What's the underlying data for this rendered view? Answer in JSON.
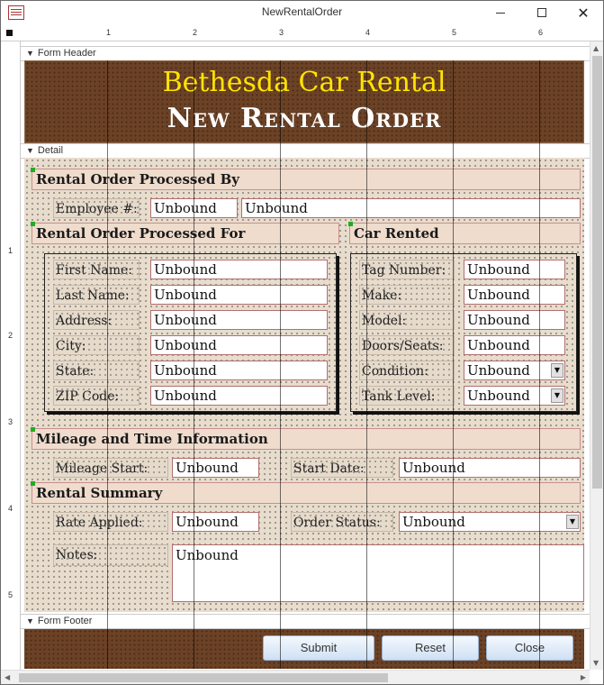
{
  "window": {
    "title": "NewRentalOrder"
  },
  "ruler": {
    "h_labels": [
      "1",
      "2",
      "3",
      "4",
      "5",
      "6"
    ],
    "v_labels": [
      "1",
      "2",
      "3",
      "4",
      "5"
    ]
  },
  "sections": {
    "header": "Form Header",
    "detail": "Detail",
    "footer": "Form Footer"
  },
  "header": {
    "company": "Bethesda Car Rental",
    "form_title": "New Rental Order"
  },
  "processed_by": {
    "band": "Rental Order Processed By",
    "employee_label": "Employee #:",
    "employee_number": "Unbound",
    "employee_name": "Unbound"
  },
  "processed_for": {
    "band": "Rental Order Processed For",
    "fields": [
      {
        "label": "First Name:",
        "value": "Unbound"
      },
      {
        "label": "Last Name:",
        "value": "Unbound"
      },
      {
        "label": "Address:",
        "value": "Unbound"
      },
      {
        "label": "City:",
        "value": "Unbound"
      },
      {
        "label": "State:",
        "value": "Unbound"
      },
      {
        "label": "ZIP Code:",
        "value": "Unbound"
      }
    ]
  },
  "car_rented": {
    "band": "Car Rented",
    "fields": [
      {
        "label": "Tag Number:",
        "value": "Unbound"
      },
      {
        "label": "Make:",
        "value": "Unbound"
      },
      {
        "label": "Model:",
        "value": "Unbound"
      },
      {
        "label": "Doors/Seats:",
        "value": "Unbound"
      },
      {
        "label": "Condition:",
        "value": "Unbound"
      },
      {
        "label": "Tank Level:",
        "value": "Unbound"
      }
    ]
  },
  "mileage": {
    "band": "Mileage and Time Information",
    "mileage_start_label": "Mileage Start:",
    "mileage_start": "Unbound",
    "start_date_label": "Start Date:",
    "start_date": "Unbound"
  },
  "summary": {
    "band": "Rental Summary",
    "rate_label": "Rate Applied:",
    "rate": "Unbound",
    "status_label": "Order Status:",
    "status": "Unbound",
    "notes_label": "Notes:",
    "notes": "Unbound"
  },
  "footer": {
    "submit": "Submit",
    "reset": "Reset",
    "close": "Close"
  },
  "icons": {
    "dropdown": "▼",
    "section_arrow": "▼",
    "close": "✕"
  },
  "colors": {
    "header_bg": "#6b4226",
    "company_text": "#ffe400",
    "band_bg": "#efdccd",
    "band_border": "#c98f8f"
  }
}
